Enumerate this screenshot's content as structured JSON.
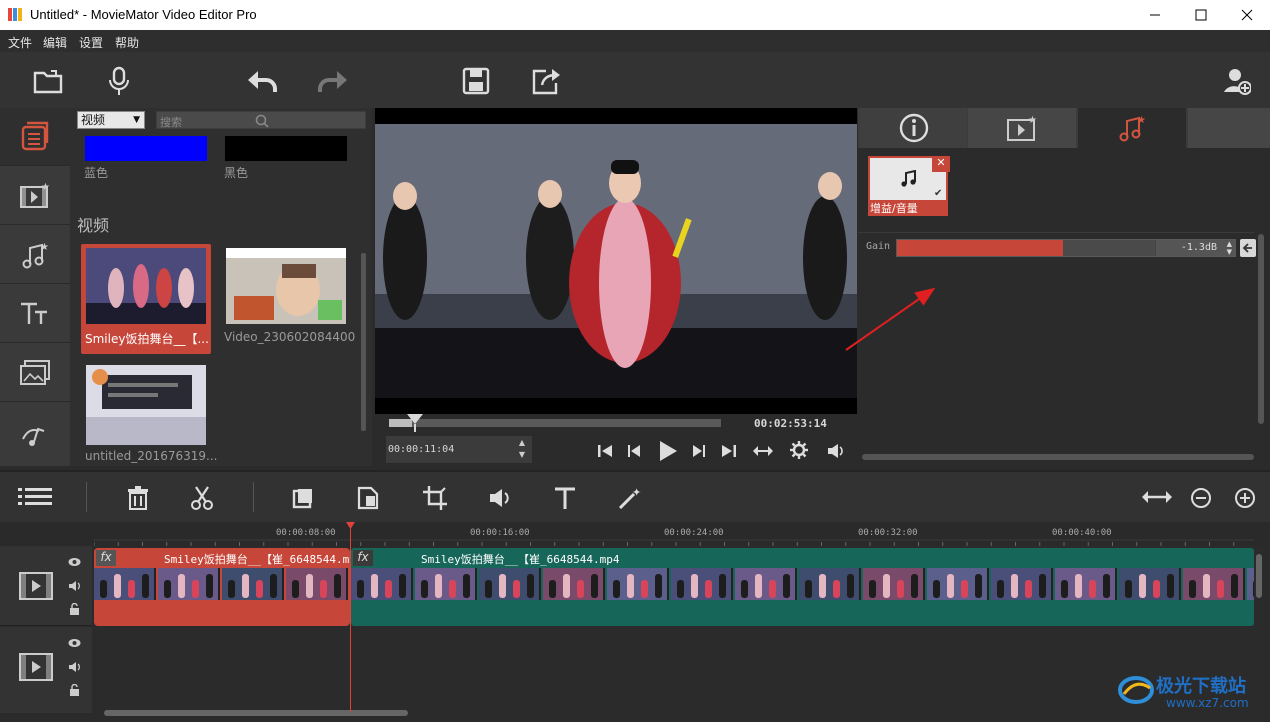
{
  "window": {
    "title": "Untitled* - MovieMator Video Editor Pro"
  },
  "menu": [
    "文件",
    "编辑",
    "设置",
    "帮助"
  ],
  "library": {
    "filter_value": "视频",
    "search_placeholder": "搜索",
    "colors": [
      {
        "label": "蓝色",
        "swatch": "#0000ff"
      },
      {
        "label": "黑色",
        "swatch": "#000000"
      }
    ],
    "section_title": "视频",
    "clips": [
      {
        "label": "Smiley饭拍舞台__【..."
      },
      {
        "label": "Video_230602084400"
      },
      {
        "label": "untitled_201676319..."
      }
    ]
  },
  "preview": {
    "duration": "00:02:53:14",
    "current_time": "00:00:11:04",
    "progress_fraction": 0.07
  },
  "right_panel": {
    "filter_name": "增益/音量",
    "gain_label": "Gain",
    "gain_value": "-1.3dB",
    "gain_fraction": 0.49
  },
  "ruler": {
    "ticks": [
      "00:00:08:00",
      "00:00:16:00",
      "00:00:24:00",
      "00:00:32:00",
      "00:00:40:00"
    ]
  },
  "timeline": {
    "clip1_name": "Smiley饭拍舞台__【崔_6648544.mp4",
    "clip2_name": "Smiley饭拍舞台__【崔_6648544.mp4",
    "fx_label": "fx"
  },
  "watermark": {
    "name": "极光下载站",
    "url": "www.xz7.com"
  },
  "colors": {
    "accent": "#c6473a",
    "clip_teal": "#17665a",
    "playhead": "#e0413b"
  }
}
